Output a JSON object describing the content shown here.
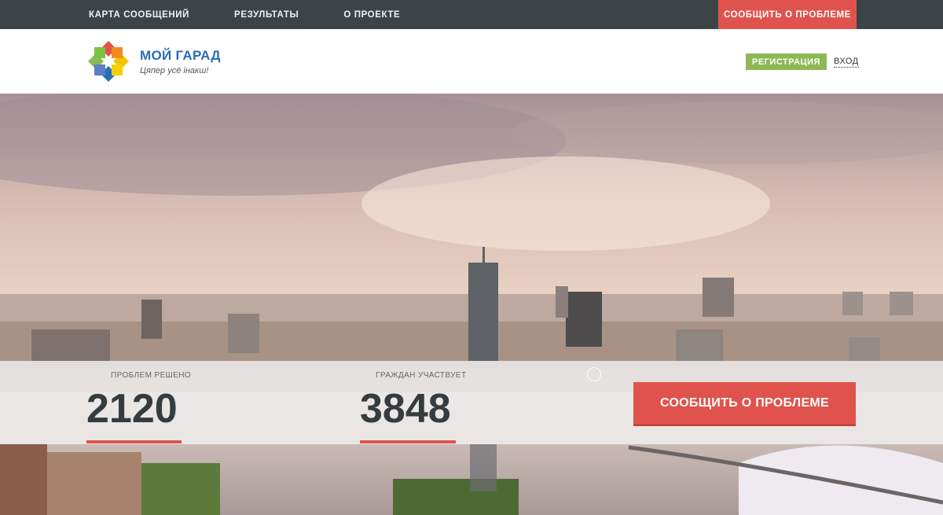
{
  "nav": {
    "items": [
      {
        "label": "КАРТА СООБЩЕНИЙ"
      },
      {
        "label": "РЕЗУЛЬТАТЫ"
      },
      {
        "label": "О ПРОЕКТЕ"
      }
    ],
    "report_button": "СООБЩИТЬ О ПРОБЛЕМЕ"
  },
  "header": {
    "logo_title": "МОЙ ГАРАД",
    "logo_slogan": "Цяпер усё інакш!",
    "register_button": "РЕГИСТРАЦИЯ",
    "login_link": "ВХОД"
  },
  "stats": {
    "solved_label": "ПРОБЛЕМ РЕШЕНО",
    "solved_value": "2120",
    "citizens_label": "ГРАЖДАН УЧАСТВУЕТ",
    "citizens_value": "3848",
    "report_button": "СООБЩИТЬ О ПРОБЛЕМЕ"
  },
  "colors": {
    "accent_red": "#e0534c",
    "accent_green": "#8cb954",
    "topbar": "#3d4447",
    "logo_blue": "#2a6db5"
  },
  "icons": {
    "logo": "mosaic-star-logo",
    "loader": "loading-spinner-icon"
  }
}
